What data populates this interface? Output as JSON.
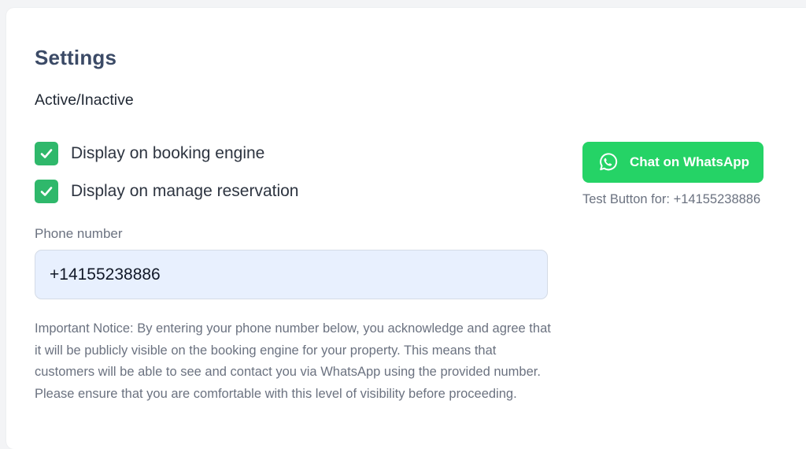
{
  "settings": {
    "title": "Settings",
    "section_label": "Active/Inactive",
    "checkboxes": [
      {
        "label": "Display on booking engine",
        "checked": true
      },
      {
        "label": "Display on manage reservation",
        "checked": true
      }
    ],
    "phone": {
      "label": "Phone number",
      "value": "+14155238886"
    },
    "notice": "Important Notice: By entering your phone number below, you acknowledge and agree that it will be publicly visible on the booking engine for your property. This means that customers will be able to see and contact you via WhatsApp using the provided number. Please ensure that you are comfortable with this level of visibility before proceeding."
  },
  "whatsapp": {
    "button_label": "Chat on WhatsApp",
    "button_icon": "whatsapp-icon",
    "test_caption_prefix": "Test Button for:",
    "test_caption_number": "+14155238886"
  },
  "colors": {
    "title": "#3b4a66",
    "checkbox": "#2fb86b",
    "whatsapp_green": "#25d366",
    "input_background": "#e8f0fe",
    "muted_text": "#6b7280"
  }
}
